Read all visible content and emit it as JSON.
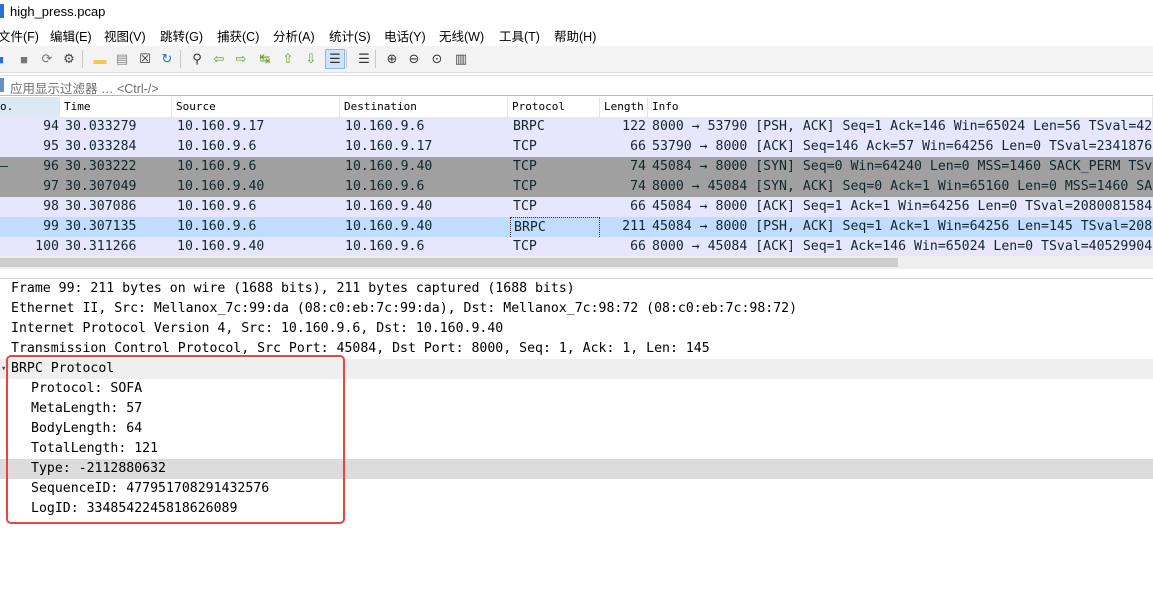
{
  "window": {
    "title": "high_press.pcap"
  },
  "menu": [
    "文件(F)",
    "编辑(E)",
    "视图(V)",
    "跳转(G)",
    "捕获(C)",
    "分析(A)",
    "统计(S)",
    "电话(Y)",
    "无线(W)",
    "工具(T)",
    "帮助(H)"
  ],
  "toolbar": {
    "icons": [
      "start-capture-icon",
      "stop-capture-icon",
      "restart-capture-icon",
      "capture-options-icon",
      "open-file-icon",
      "save-file-icon",
      "close-file-icon",
      "reload-file-icon",
      "find-packet-icon",
      "go-back-icon",
      "go-forward-icon",
      "go-to-packet-icon",
      "go-first-icon",
      "go-last-icon",
      "autoscroll-icon",
      "colorize-icon",
      "zoom-in-icon",
      "zoom-out-icon",
      "zoom-normal-icon",
      "resize-columns-icon"
    ],
    "selected": [
      "autoscroll-icon"
    ]
  },
  "filter": {
    "placeholder": "应用显示过滤器 … <Ctrl-/>"
  },
  "packet_list": {
    "columns": [
      "o.",
      "Time",
      "Source",
      "Destination",
      "Protocol",
      "Length",
      "Info"
    ],
    "rows": [
      {
        "no": "94",
        "time": "30.033279",
        "src": "10.160.9.17",
        "dst": "10.160.9.6",
        "proto": "BRPC",
        "len": "122",
        "info": "8000 → 53790 [PSH, ACK] Seq=1 Ack=146 Win=65024 Len=56 TSval=42",
        "bg": "#e7e6ff",
        "fg": "#12272e",
        "marker": ""
      },
      {
        "no": "95",
        "time": "30.033284",
        "src": "10.160.9.6",
        "dst": "10.160.9.17",
        "proto": "TCP",
        "len": "66",
        "info": "53790 → 8000 [ACK] Seq=146 Ack=57 Win=64256 Len=0 TSval=2341876",
        "bg": "#e7e6ff",
        "fg": "#12272e",
        "marker": ""
      },
      {
        "no": "96",
        "time": "30.303222",
        "src": "10.160.9.6",
        "dst": "10.160.9.40",
        "proto": "TCP",
        "len": "74",
        "info": "45084 → 8000 [SYN] Seq=0 Win=64240 Len=0 MSS=1460 SACK_PERM TSv",
        "bg": "#a0a0a0",
        "fg": "#12272e",
        "marker": "–"
      },
      {
        "no": "97",
        "time": "30.307049",
        "src": "10.160.9.40",
        "dst": "10.160.9.6",
        "proto": "TCP",
        "len": "74",
        "info": "8000 → 45084 [SYN, ACK] Seq=0 Ack=1 Win=65160 Len=0 MSS=1460 SA",
        "bg": "#a0a0a0",
        "fg": "#12272e",
        "marker": ""
      },
      {
        "no": "98",
        "time": "30.307086",
        "src": "10.160.9.6",
        "dst": "10.160.9.40",
        "proto": "TCP",
        "len": "66",
        "info": "45084 → 8000 [ACK] Seq=1 Ack=1 Win=64256 Len=0 TSval=2080081584",
        "bg": "#e7e6ff",
        "fg": "#12272e",
        "marker": ""
      },
      {
        "no": "99",
        "time": "30.307135",
        "src": "10.160.9.6",
        "dst": "10.160.9.40",
        "proto": "BRPC",
        "len": "211",
        "info": "45084 → 8000 [PSH, ACK] Seq=1 Ack=1 Win=64256 Len=145 TSval=208",
        "bg": "#c0dcff",
        "fg": "#12272e",
        "marker": ""
      },
      {
        "no": "100",
        "time": "30.311266",
        "src": "10.160.9.40",
        "dst": "10.160.9.6",
        "proto": "TCP",
        "len": "66",
        "info": "8000 → 45084 [ACK] Seq=1 Ack=146 Win=65024 Len=0 TSval=40529904",
        "bg": "#e7e6ff",
        "fg": "#12272e",
        "marker": ""
      }
    ]
  },
  "details": [
    {
      "text": "Frame 99: 211 bytes on wire (1688 bits), 211 bytes captured (1688 bits)",
      "level": 0,
      "style": "normal"
    },
    {
      "text": "Ethernet II, Src: Mellanox_7c:99:da (08:c0:eb:7c:99:da), Dst: Mellanox_7c:98:72 (08:c0:eb:7c:98:72)",
      "level": 0,
      "style": "normal"
    },
    {
      "text": "Internet Protocol Version 4, Src: 10.160.9.6, Dst: 10.160.9.40",
      "level": 0,
      "style": "normal"
    },
    {
      "text": "Transmission Control Protocol, Src Port: 45084, Dst Port: 8000, Seq: 1, Ack: 1, Len: 145",
      "level": 0,
      "style": "normal"
    },
    {
      "text": "BRPC Protocol",
      "level": 0,
      "style": "section"
    },
    {
      "text": "Protocol: SOFA",
      "level": 1,
      "style": "normal"
    },
    {
      "text": "MetaLength: 57",
      "level": 1,
      "style": "normal"
    },
    {
      "text": "BodyLength: 64",
      "level": 1,
      "style": "normal"
    },
    {
      "text": "TotalLength: 121",
      "level": 1,
      "style": "normal"
    },
    {
      "text": "Type: -2112880632",
      "level": 1,
      "style": "highlight"
    },
    {
      "text": "SequenceID: 477951708291432576",
      "level": 1,
      "style": "normal"
    },
    {
      "text": "LogID: 3348542245818626089",
      "level": 1,
      "style": "normal"
    }
  ],
  "colors": {
    "annotation_box": "#e04848",
    "selected_row": "#c0dcff"
  }
}
